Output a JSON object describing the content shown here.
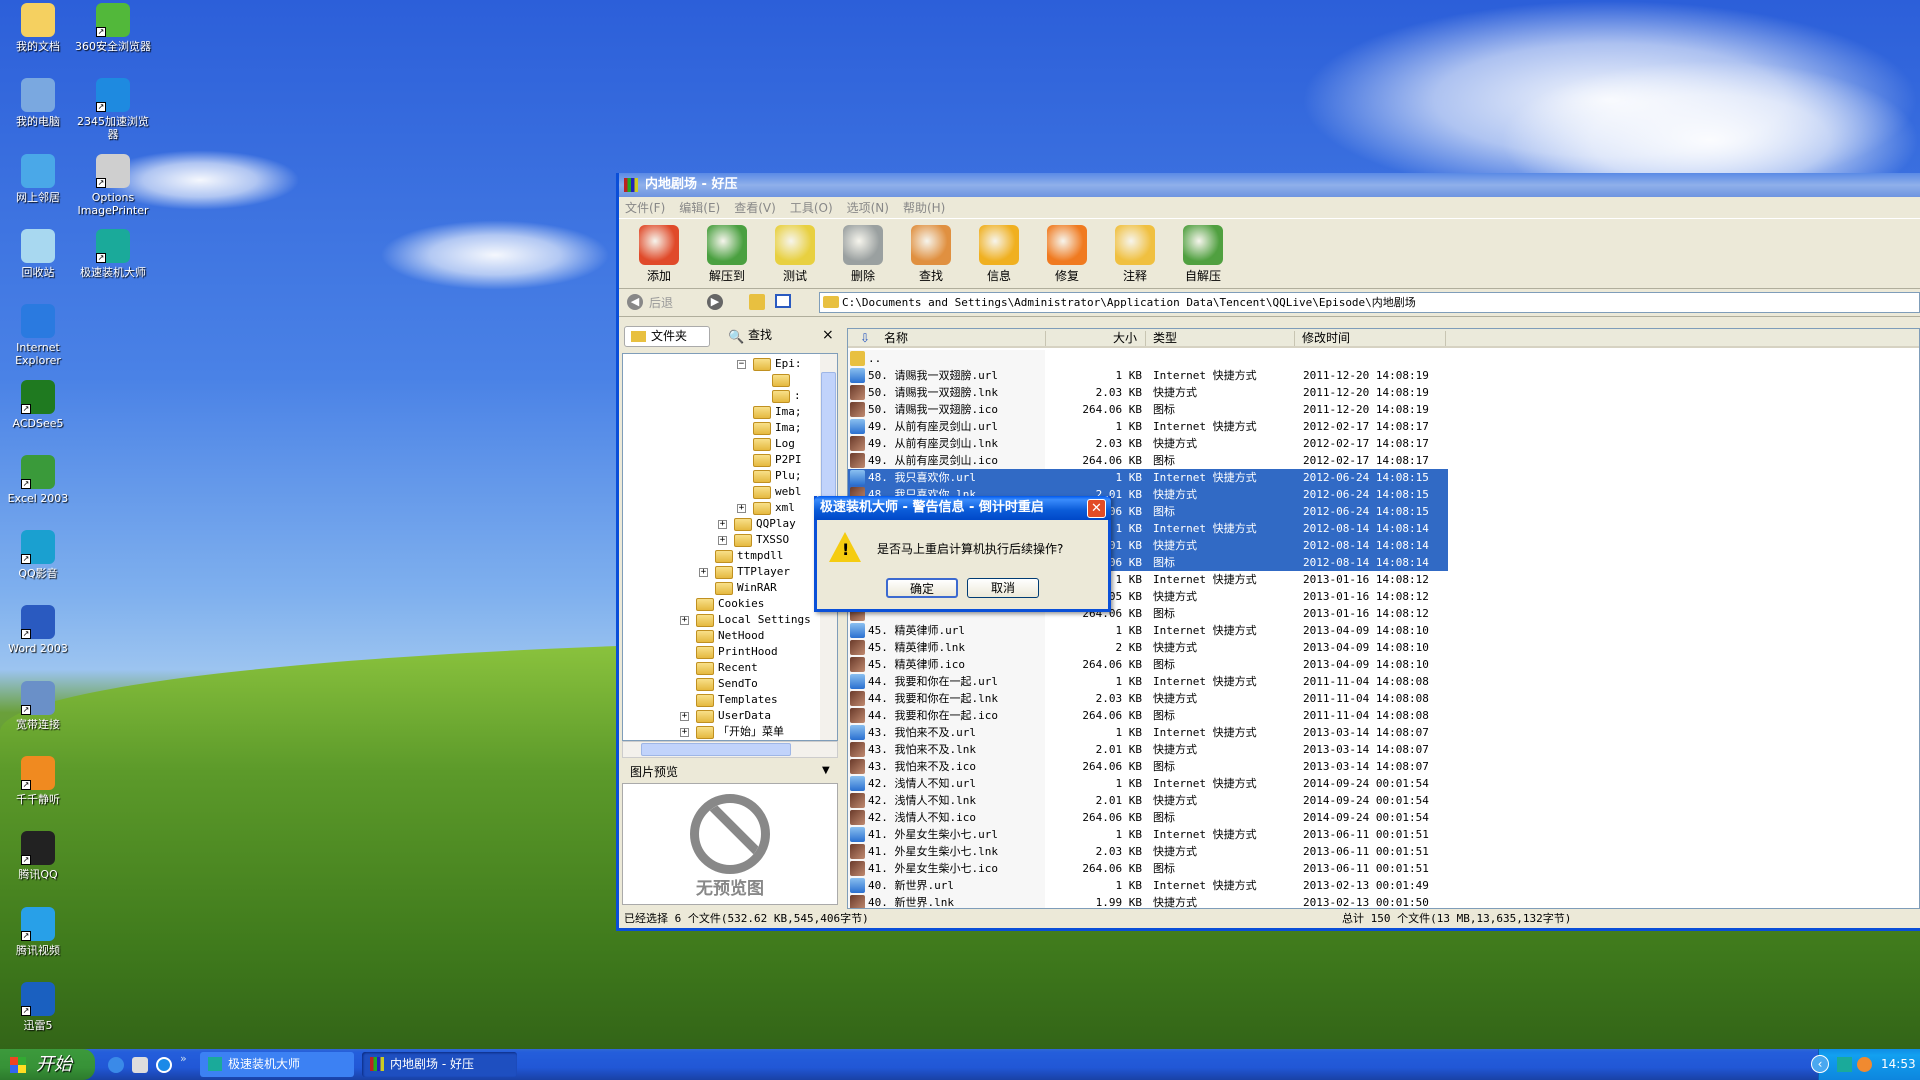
{
  "desktop": {
    "icons": [
      {
        "label": "我的文档",
        "col": 0,
        "color": "#f5d060"
      },
      {
        "label": "360安全浏览器",
        "col": 1,
        "color": "#52b83a",
        "shortcut": true
      },
      {
        "label": "我的电脑",
        "col": 0,
        "color": "#7aa8e0"
      },
      {
        "label": "2345加速浏览器",
        "col": 1,
        "color": "#1e8ae0",
        "shortcut": true
      },
      {
        "label": "网上邻居",
        "col": 0,
        "color": "#4aa8e8"
      },
      {
        "label": "Options ImagePrinter",
        "col": 1,
        "color": "#cfcfcf",
        "shortcut": true
      },
      {
        "label": "回收站",
        "col": 0,
        "color": "#a8d8f0"
      },
      {
        "label": "极速装机大师",
        "col": 1,
        "color": "#1aaa9a",
        "shortcut": true
      },
      {
        "label": "Internet Explorer",
        "col": 0,
        "color": "#2a7ae0"
      },
      {
        "label": "ACDSee5",
        "col": 0,
        "color": "#1f7a20",
        "shortcut": true
      },
      {
        "label": "Excel 2003",
        "col": 0,
        "color": "#3a9a3a",
        "shortcut": true
      },
      {
        "label": "QQ影音",
        "col": 0,
        "color": "#1aa0d0",
        "shortcut": true
      },
      {
        "label": "Word 2003",
        "col": 0,
        "color": "#2a5ac0",
        "shortcut": true
      },
      {
        "label": "宽带连接",
        "col": 0,
        "color": "#6a90c8",
        "shortcut": true
      },
      {
        "label": "千千静听",
        "col": 0,
        "color": "#f08a20",
        "shortcut": true
      },
      {
        "label": "腾讯QQ",
        "col": 0,
        "color": "#222",
        "shortcut": true
      },
      {
        "label": "腾讯视频",
        "col": 0,
        "color": "#28a0e8",
        "shortcut": true
      },
      {
        "label": "迅雷5",
        "col": 0,
        "color": "#1a60c0",
        "shortcut": true
      }
    ]
  },
  "window": {
    "title": "内地剧场 - 好压",
    "menu": [
      "文件(F)",
      "编辑(E)",
      "查看(V)",
      "工具(O)",
      "选项(N)",
      "帮助(H)"
    ],
    "toolbar": [
      {
        "label": "添加",
        "color": "#e04a2a"
      },
      {
        "label": "解压到",
        "color": "#4aa040"
      },
      {
        "label": "测试",
        "color": "#e8d040"
      },
      {
        "label": "删除",
        "color": "#9aa0a0"
      },
      {
        "label": "查找",
        "color": "#e09040"
      },
      {
        "label": "信息",
        "color": "#f0b020"
      },
      {
        "label": "修复",
        "color": "#f07a20"
      },
      {
        "label": "注释",
        "color": "#f0c040"
      },
      {
        "label": "自解压",
        "color": "#50a040"
      }
    ],
    "nav": {
      "back": "后退",
      "path": "C:\\Documents and Settings\\Administrator\\Application Data\\Tencent\\QQLive\\Episode\\内地剧场"
    },
    "left_tabs": {
      "folders": "文件夹",
      "search": "查找",
      "close": "×"
    },
    "tree": [
      {
        "label": "Epi:",
        "depth": 6,
        "expanded": true
      },
      {
        "label": "",
        "depth": 7
      },
      {
        "label": ":",
        "depth": 7
      },
      {
        "label": "Ima;",
        "depth": 6
      },
      {
        "label": "Ima;",
        "depth": 6
      },
      {
        "label": "Log",
        "depth": 6
      },
      {
        "label": "P2PI",
        "depth": 6
      },
      {
        "label": "Plu;",
        "depth": 6
      },
      {
        "label": "webl",
        "depth": 6
      },
      {
        "label": "xml",
        "depth": 6,
        "plus": true
      },
      {
        "label": "QQPlay",
        "depth": 5,
        "plus": true
      },
      {
        "label": "TXSSO",
        "depth": 5,
        "plus": true
      },
      {
        "label": "ttmpdll",
        "depth": 4
      },
      {
        "label": "TTPlayer",
        "depth": 4,
        "plus": true
      },
      {
        "label": "WinRAR",
        "depth": 4
      },
      {
        "label": "Cookies",
        "depth": 3
      },
      {
        "label": "Local Settings",
        "depth": 3,
        "plus": true
      },
      {
        "label": "NetHood",
        "depth": 3
      },
      {
        "label": "PrintHood",
        "depth": 3
      },
      {
        "label": "Recent",
        "depth": 3
      },
      {
        "label": "SendTo",
        "depth": 3
      },
      {
        "label": "Templates",
        "depth": 3
      },
      {
        "label": "UserData",
        "depth": 3,
        "plus": true
      },
      {
        "label": "「开始」菜单",
        "depth": 3,
        "plus": true
      }
    ],
    "preview": {
      "header": "图片预览",
      "empty": "无预览图"
    },
    "columns": {
      "name": "名称",
      "size": "大小",
      "type": "类型",
      "modified": "修改时间"
    },
    "files": [
      {
        "name": "..",
        "size": "",
        "type": "",
        "date": "",
        "kind": "folder"
      },
      {
        "name": "50. 请赐我一双翅膀.url",
        "size": "1 KB",
        "type": "Internet 快捷方式",
        "date": "2011-12-20 14:08:19",
        "kind": "url"
      },
      {
        "name": "50. 请赐我一双翅膀.lnk",
        "size": "2.03 KB",
        "type": "快捷方式",
        "date": "2011-12-20 14:08:19",
        "kind": "img"
      },
      {
        "name": "50. 请赐我一双翅膀.ico",
        "size": "264.06 KB",
        "type": "图标",
        "date": "2011-12-20 14:08:19",
        "kind": "img"
      },
      {
        "name": "49. 从前有座灵剑山.url",
        "size": "1 KB",
        "type": "Internet 快捷方式",
        "date": "2012-02-17 14:08:17",
        "kind": "url"
      },
      {
        "name": "49. 从前有座灵剑山.lnk",
        "size": "2.03 KB",
        "type": "快捷方式",
        "date": "2012-02-17 14:08:17",
        "kind": "img"
      },
      {
        "name": "49. 从前有座灵剑山.ico",
        "size": "264.06 KB",
        "type": "图标",
        "date": "2012-02-17 14:08:17",
        "kind": "img"
      },
      {
        "name": "48. 我只喜欢你.url",
        "size": "1 KB",
        "type": "Internet 快捷方式",
        "date": "2012-06-24 14:08:15",
        "kind": "url",
        "selected": true
      },
      {
        "name": "48. 我只喜欢你.lnk",
        "size": "2.01 KB",
        "type": "快捷方式",
        "date": "2012-06-24 14:08:15",
        "kind": "img",
        "selected": true
      },
      {
        "name": "",
        "size": "264.06 KB",
        "type": "图标",
        "date": "2012-06-24 14:08:15",
        "kind": "img",
        "selected": true
      },
      {
        "name": "",
        "size": "1 KB",
        "type": "Internet 快捷方式",
        "date": "2012-08-14 14:08:14",
        "kind": "url",
        "selected": true
      },
      {
        "name": "",
        "size": "2.01 KB",
        "type": "快捷方式",
        "date": "2012-08-14 14:08:14",
        "kind": "img",
        "selected": true
      },
      {
        "name": "",
        "size": "264.06 KB",
        "type": "图标",
        "date": "2012-08-14 14:08:14",
        "kind": "img",
        "selected": true
      },
      {
        "name": "",
        "size": "1 KB",
        "type": "Internet 快捷方式",
        "date": "2013-01-16 14:08:12",
        "kind": "url"
      },
      {
        "name": "",
        "size": "2.05 KB",
        "type": "快捷方式",
        "date": "2013-01-16 14:08:12",
        "kind": "img"
      },
      {
        "name": "",
        "size": "264.06 KB",
        "type": "图标",
        "date": "2013-01-16 14:08:12",
        "kind": "img"
      },
      {
        "name": "45. 精英律师.url",
        "size": "1 KB",
        "type": "Internet 快捷方式",
        "date": "2013-04-09 14:08:10",
        "kind": "url"
      },
      {
        "name": "45. 精英律师.lnk",
        "size": "2 KB",
        "type": "快捷方式",
        "date": "2013-04-09 14:08:10",
        "kind": "img"
      },
      {
        "name": "45. 精英律师.ico",
        "size": "264.06 KB",
        "type": "图标",
        "date": "2013-04-09 14:08:10",
        "kind": "img"
      },
      {
        "name": "44. 我要和你在一起.url",
        "size": "1 KB",
        "type": "Internet 快捷方式",
        "date": "2011-11-04 14:08:08",
        "kind": "url"
      },
      {
        "name": "44. 我要和你在一起.lnk",
        "size": "2.03 KB",
        "type": "快捷方式",
        "date": "2011-11-04 14:08:08",
        "kind": "img"
      },
      {
        "name": "44. 我要和你在一起.ico",
        "size": "264.06 KB",
        "type": "图标",
        "date": "2011-11-04 14:08:08",
        "kind": "img"
      },
      {
        "name": "43. 我怕来不及.url",
        "size": "1 KB",
        "type": "Internet 快捷方式",
        "date": "2013-03-14 14:08:07",
        "kind": "url"
      },
      {
        "name": "43. 我怕来不及.lnk",
        "size": "2.01 KB",
        "type": "快捷方式",
        "date": "2013-03-14 14:08:07",
        "kind": "img"
      },
      {
        "name": "43. 我怕来不及.ico",
        "size": "264.06 KB",
        "type": "图标",
        "date": "2013-03-14 14:08:07",
        "kind": "img"
      },
      {
        "name": "42. 浅情人不知.url",
        "size": "1 KB",
        "type": "Internet 快捷方式",
        "date": "2014-09-24 00:01:54",
        "kind": "url"
      },
      {
        "name": "42. 浅情人不知.lnk",
        "size": "2.01 KB",
        "type": "快捷方式",
        "date": "2014-09-24 00:01:54",
        "kind": "img"
      },
      {
        "name": "42. 浅情人不知.ico",
        "size": "264.06 KB",
        "type": "图标",
        "date": "2014-09-24 00:01:54",
        "kind": "img"
      },
      {
        "name": "41. 外星女生柴小七.url",
        "size": "1 KB",
        "type": "Internet 快捷方式",
        "date": "2013-06-11 00:01:51",
        "kind": "url"
      },
      {
        "name": "41. 外星女生柴小七.lnk",
        "size": "2.03 KB",
        "type": "快捷方式",
        "date": "2013-06-11 00:01:51",
        "kind": "img"
      },
      {
        "name": "41. 外星女生柴小七.ico",
        "size": "264.06 KB",
        "type": "图标",
        "date": "2013-06-11 00:01:51",
        "kind": "img"
      },
      {
        "name": "40. 新世界.url",
        "size": "1 KB",
        "type": "Internet 快捷方式",
        "date": "2013-02-13 00:01:49",
        "kind": "url"
      },
      {
        "name": "40. 新世界.lnk",
        "size": "1.99 KB",
        "type": "快捷方式",
        "date": "2013-02-13 00:01:50",
        "kind": "img"
      }
    ],
    "status": {
      "selected": "已经选择 6 个文件(532.62 KB,545,406字节)",
      "total": "总计 150 个文件(13 MB,13,635,132字节)"
    }
  },
  "dialog": {
    "title": "极速装机大师 - 警告信息 - 倒计时重启",
    "message": "是否马上重启计算机执行后续操作?",
    "ok": "确定",
    "cancel": "取消"
  },
  "taskbar": {
    "start": "开始",
    "tasks": [
      "极速装机大师",
      "内地剧场 - 好压"
    ],
    "clock": "14:53"
  }
}
